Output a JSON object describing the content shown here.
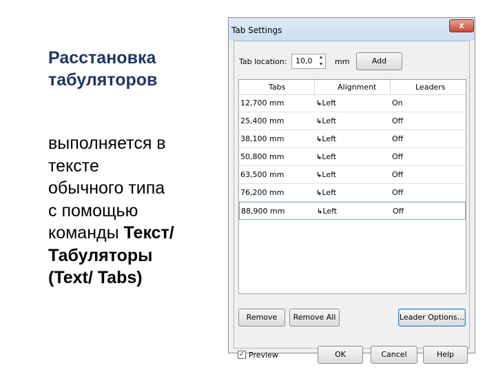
{
  "slide": {
    "title_line1": "Расстановка",
    "title_line2": "табуляторов",
    "body_line1": "выполняется  в",
    "body_line2": "тексте",
    "body_line3": "обычного типа",
    "body_line4": "с помощью",
    "body_line5_plain": "команды ",
    "body_line5_bold": "Текст/",
    "body_line6": "Табуляторы",
    "body_line7": "(Text/ Tabs)"
  },
  "dialog": {
    "title": "Tab Settings",
    "close_glyph": "x",
    "tab_location_label": "Tab location:",
    "tab_location_value": "10,0",
    "unit": "mm",
    "add_label": "Add",
    "columns": [
      "Tabs",
      "Alignment",
      "Leaders"
    ],
    "rows": [
      {
        "tab": "12,700 mm",
        "alignment": "Left",
        "leaders": "On"
      },
      {
        "tab": "25,400 mm",
        "alignment": "Left",
        "leaders": "Off"
      },
      {
        "tab": "38,100 mm",
        "alignment": "Left",
        "leaders": "Off"
      },
      {
        "tab": "50,800 mm",
        "alignment": "Left",
        "leaders": "Off"
      },
      {
        "tab": "63,500 mm",
        "alignment": "Left",
        "leaders": "Off"
      },
      {
        "tab": "76,200 mm",
        "alignment": "Left",
        "leaders": "Off"
      },
      {
        "tab": "88,900 mm",
        "alignment": "Left",
        "leaders": "Off"
      }
    ],
    "tab_glyph": "↳",
    "remove_label": "Remove",
    "remove_all_label": "Remove All",
    "leader_options_label": "Leader Options...",
    "preview_label": "Preview",
    "preview_checked": true,
    "ok_label": "OK",
    "cancel_label": "Cancel",
    "help_label": "Help"
  }
}
